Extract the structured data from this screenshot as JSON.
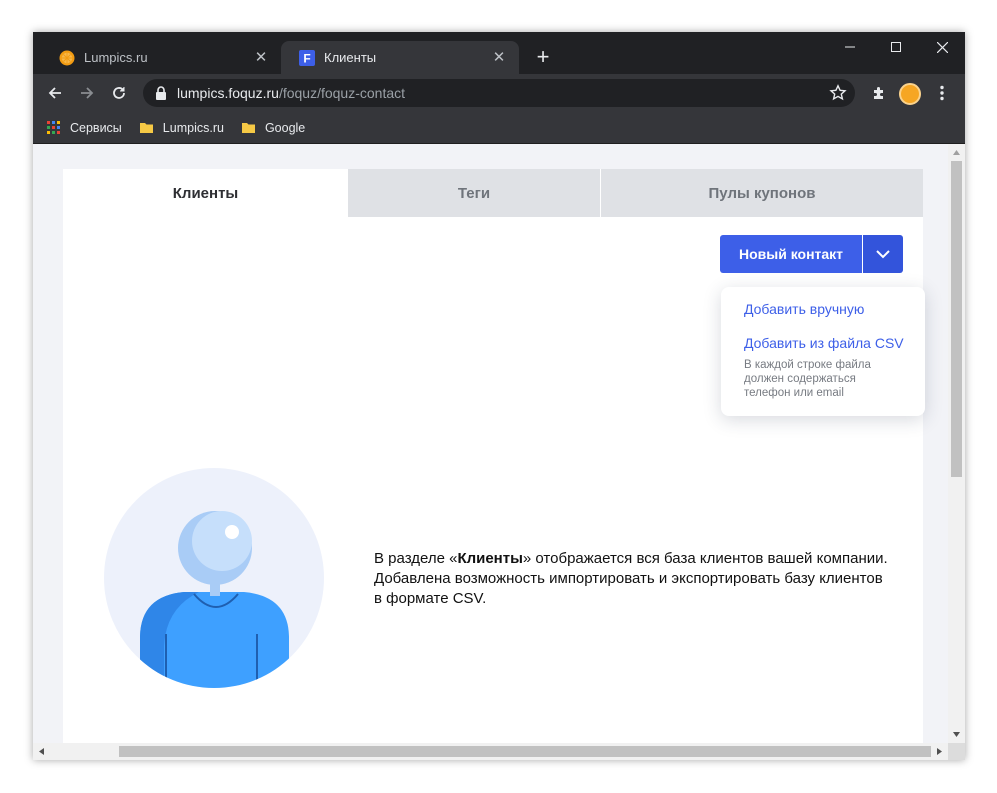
{
  "browser": {
    "tabs": [
      {
        "label": "Lumpics.ru",
        "favicon": "orange-icon",
        "active": false
      },
      {
        "label": "Клиенты",
        "favicon": "foquz-f-icon",
        "favicon_letter": "F",
        "active": true
      }
    ],
    "url": {
      "host": "lumpics.foquz.ru",
      "path": "/foquz/foquz-contact"
    },
    "bookmarks": [
      {
        "label": "Сервисы",
        "icon": "apps-grid-icon"
      },
      {
        "label": "Lumpics.ru",
        "icon": "folder-icon"
      },
      {
        "label": "Google",
        "icon": "folder-icon"
      }
    ]
  },
  "page": {
    "tabs": [
      {
        "label": "Клиенты",
        "active": true
      },
      {
        "label": "Теги",
        "active": false
      },
      {
        "label": "Пулы купонов",
        "active": false
      }
    ],
    "new_contact_button": "Новый контакт",
    "dropdown": {
      "add_manual": "Добавить вручную",
      "add_csv": "Добавить из файла CSV",
      "csv_hint": "В каждой строке файла должен содержаться телефон или email"
    },
    "description": {
      "before": "В разделе «",
      "bold": "Клиенты",
      "after": "» отображается вся база клиентов вашей компании. Добавлена возможность импортировать и экспортировать базу клиентов в формате CSV."
    }
  },
  "colors": {
    "accent": "#3d5fe8",
    "illustration_bg": "#edf1fb",
    "illustration_body": "#3ea0ff"
  }
}
